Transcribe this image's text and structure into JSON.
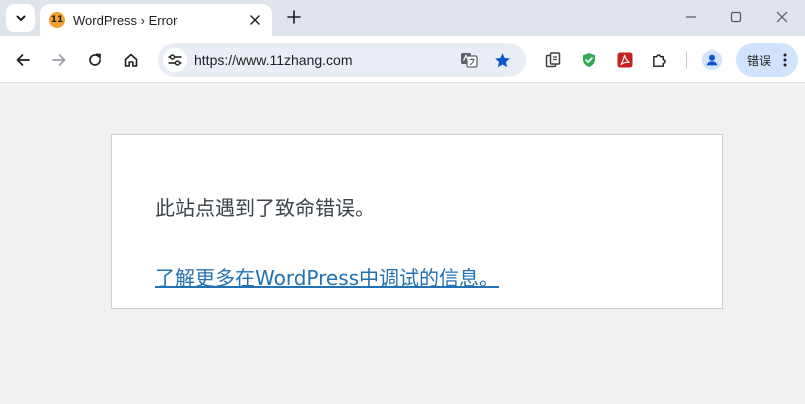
{
  "browser": {
    "tab": {
      "favicon_text": "11",
      "title": "WordPress › Error"
    },
    "address_bar": {
      "url": "https://www.11zhang.com"
    },
    "error_chip_label": "错误"
  },
  "page": {
    "error_message": "此站点遇到了致命错误。",
    "debug_link_text": "了解更多在WordPress中调试的信息。"
  },
  "colors": {
    "link": "#2271b1",
    "text": "#3c434a",
    "bookmark_star": "#0b57d0",
    "shield_extension": "#34a853",
    "pdf_extension": "#c5221f",
    "favicon": "#f2a12e"
  }
}
